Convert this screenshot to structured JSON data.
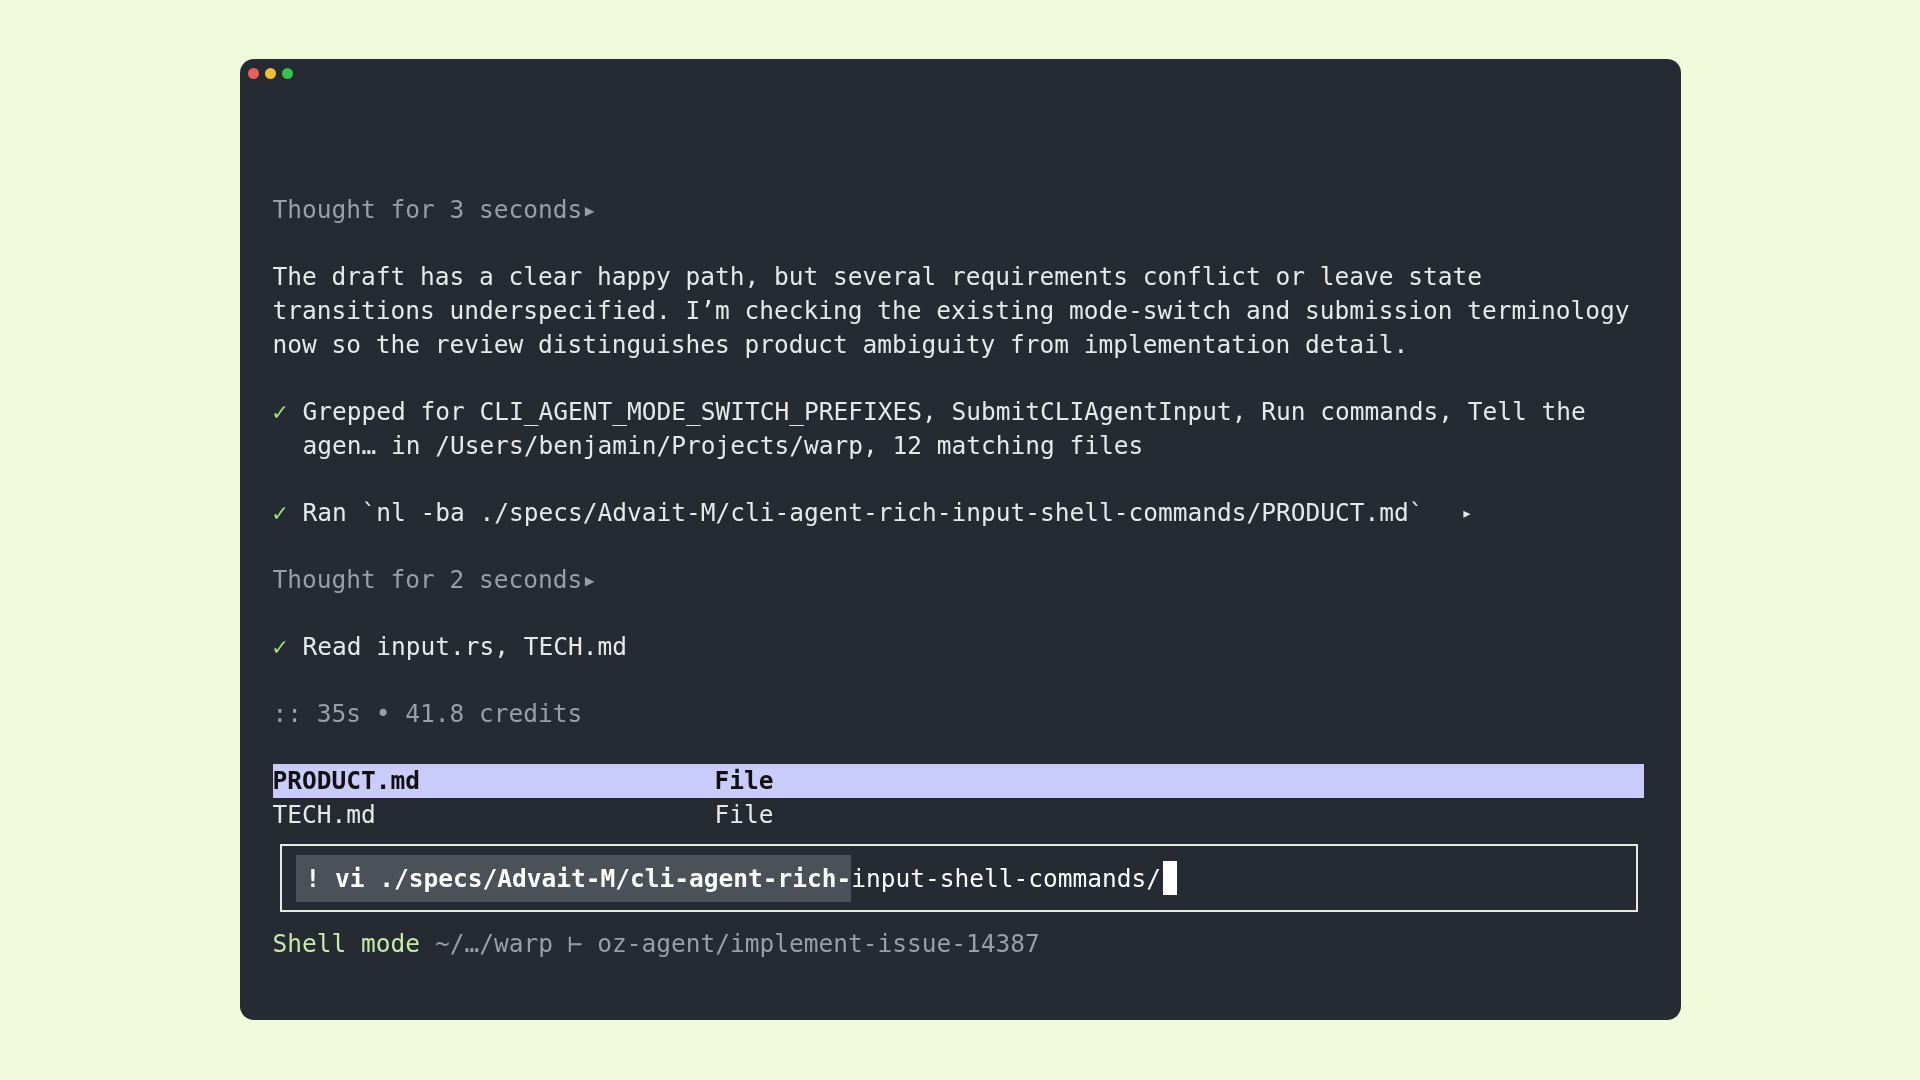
{
  "blocks": [
    {
      "kind": "thought",
      "text": "Thought for 3 seconds",
      "arrow": "▸"
    },
    {
      "kind": "paragraph",
      "text": "The draft has a clear happy path, but several requirements conflict or leave state transitions underspecified. I’m checking the existing mode-switch and submission terminology now so the review distinguishes product ambiguity from implementation detail."
    },
    {
      "kind": "tool",
      "check": "✓",
      "text": "Grepped for CLI_AGENT_MODE_SWITCH_PREFIXES, SubmitCLIAgentInput, Run commands, Tell the agen… in /Users/benjamin/Projects/warp, 12 matching files"
    },
    {
      "kind": "tool",
      "check": "✓",
      "text": "Ran `nl -ba ./specs/Advait-M/cli-agent-rich-input-shell-commands/PRODUCT.md`",
      "arrow": "▸"
    },
    {
      "kind": "thought",
      "text": "Thought for 2 seconds",
      "arrow": "▸"
    },
    {
      "kind": "tool",
      "check": "✓",
      "text": "Read input.rs, TECH.md"
    },
    {
      "kind": "meta",
      "text": ":: 35s • 41.8 credits"
    }
  ],
  "suggestions": [
    {
      "name": "PRODUCT.md",
      "type": "File",
      "selected": true
    },
    {
      "name": "TECH.md",
      "type": "File",
      "selected": false
    }
  ],
  "input": {
    "selected_text": "! vi ./specs/Advait-M/cli-agent-rich-",
    "text": "input-shell-commands/"
  },
  "status": {
    "mode": "Shell mode",
    "path": "~/…/warp ⊢ oz-agent/implement-issue-14387"
  }
}
